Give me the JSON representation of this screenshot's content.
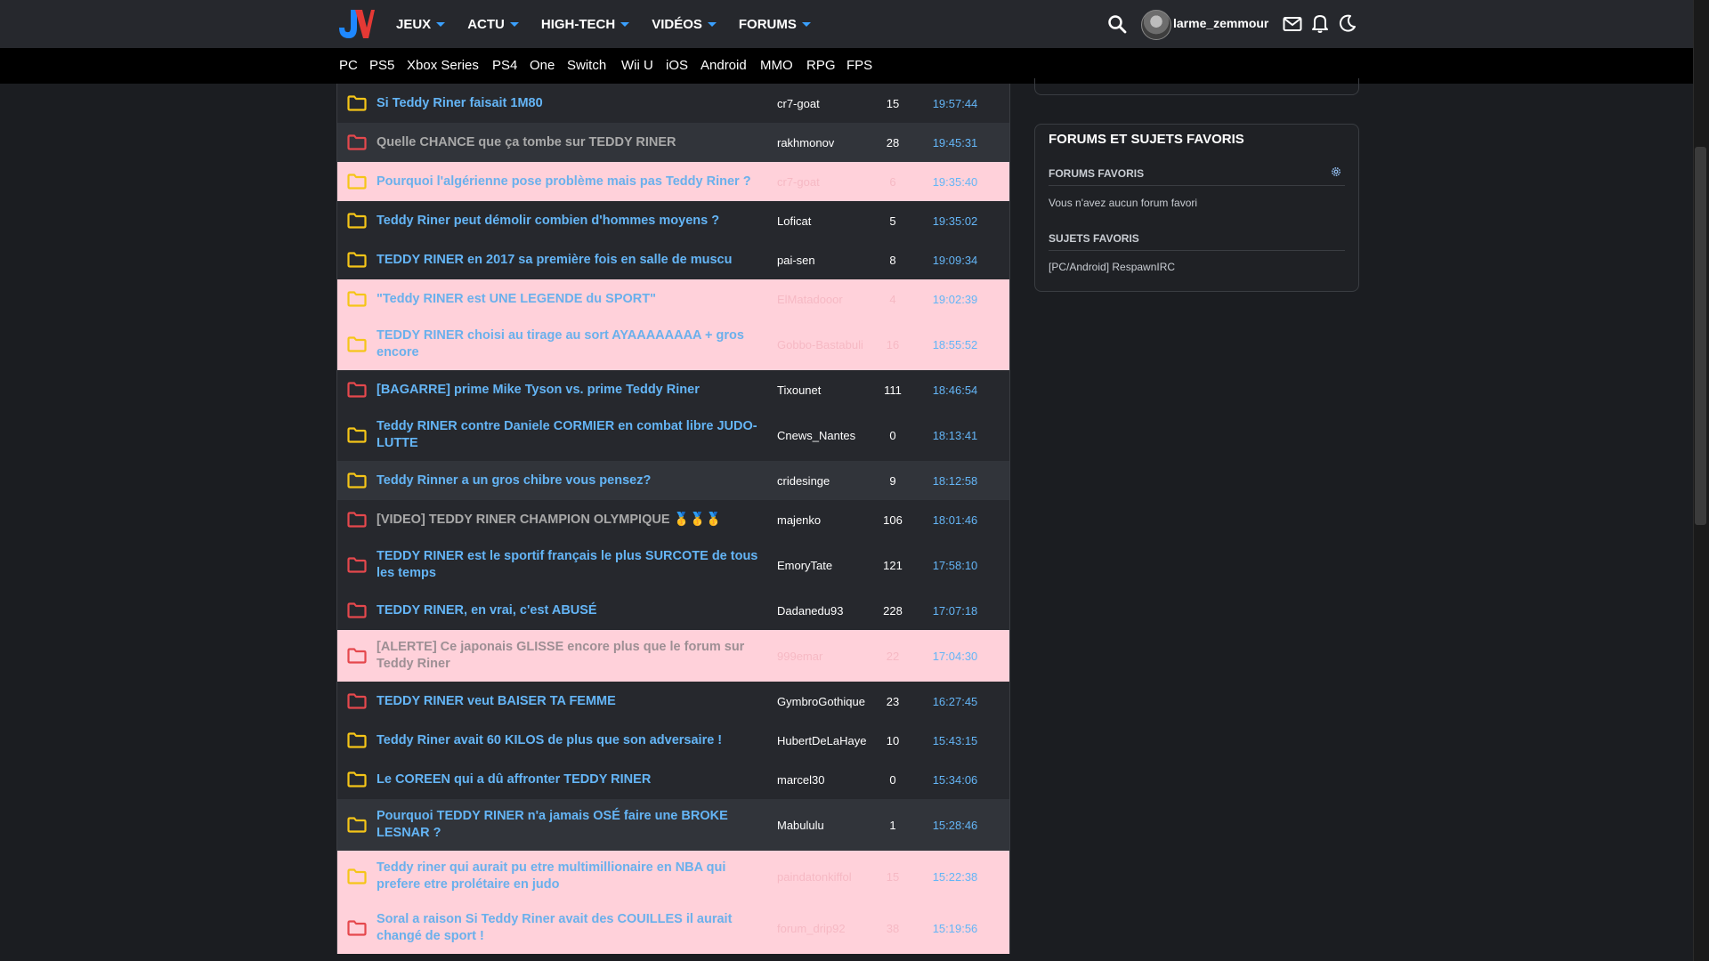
{
  "header": {
    "logo_text": "JV",
    "nav": [
      {
        "label": "JEUX"
      },
      {
        "label": "ACTU"
      },
      {
        "label": "HIGH-TECH"
      },
      {
        "label": "VIDÉOS"
      },
      {
        "label": "FORUMS"
      }
    ],
    "username": "larme_zemmour",
    "icons": [
      "search-icon",
      "mail-icon",
      "bell-icon",
      "moon-icon"
    ]
  },
  "platforms": [
    "PC",
    "PS5",
    "Xbox Series",
    "PS4",
    "One",
    "Switch",
    "Wii U",
    "iOS",
    "Android",
    "MMO",
    "RPG",
    "FPS"
  ],
  "topics": [
    {
      "title": "Si Teddy Riner faisait 1M80",
      "author": "cr7-goat",
      "count": "15",
      "time": "19:57:44",
      "folder": "yellow",
      "bg": "dark",
      "visited": false
    },
    {
      "title": "Quelle CHANCE que ça tombe sur TEDDY RINER",
      "author": "rakhmonov",
      "count": "28",
      "time": "19:45:31",
      "folder": "red",
      "bg": "med",
      "visited": true
    },
    {
      "title": "Pourquoi l'algérienne pose problème mais pas Teddy Riner ?",
      "author": "cr7-goat",
      "count": "6",
      "time": "19:35:40",
      "folder": "yellow",
      "bg": "pink",
      "visited": false
    },
    {
      "title": "Teddy Riner peut démolir combien d'hommes moyens ?",
      "author": "Loficat",
      "count": "5",
      "time": "19:35:02",
      "folder": "yellow",
      "bg": "dark",
      "visited": false
    },
    {
      "title": "TEDDY RINER en 2017 sa première fois en salle de muscu",
      "author": "pai-sen",
      "count": "8",
      "time": "19:09:34",
      "folder": "yellow",
      "bg": "dark",
      "visited": false
    },
    {
      "title": "\"Teddy RINER est UNE LEGENDE du SPORT\"",
      "author": "ElMatadooor",
      "count": "4",
      "time": "19:02:39",
      "folder": "yellow",
      "bg": "pink",
      "visited": false
    },
    {
      "title": "TEDDY RINER choisi au tirage au sort AYAAAAAAAA + gros encore",
      "author": "Gobbo-Bastabuli",
      "count": "16",
      "time": "18:55:52",
      "folder": "yellow",
      "bg": "pink",
      "visited": false
    },
    {
      "title": "[BAGARRE] prime Mike Tyson vs. prime Teddy Riner",
      "author": "Tixounet",
      "count": "111",
      "time": "18:46:54",
      "folder": "red",
      "bg": "dark",
      "visited": false
    },
    {
      "title": "Teddy RINER contre Daniele CORMIER en combat libre JUDO-LUTTE",
      "author": "Cnews_Nantes",
      "count": "0",
      "time": "18:13:41",
      "folder": "yellow",
      "bg": "dark",
      "visited": false
    },
    {
      "title": "Teddy Rinner a un gros chibre vous pensez?",
      "author": "cridesinge",
      "count": "9",
      "time": "18:12:58",
      "folder": "yellow",
      "bg": "med",
      "visited": false
    },
    {
      "title": "[VIDEO] TEDDY RINER CHAMPION OLYMPIQUE 🥇🥇🥇",
      "author": "majenko",
      "count": "106",
      "time": "18:01:46",
      "folder": "red",
      "bg": "dark",
      "visited": true
    },
    {
      "title": "TEDDY RINER est le sportif français le plus SURCOTE de tous les temps",
      "author": "EmoryTate",
      "count": "121",
      "time": "17:58:10",
      "folder": "red",
      "bg": "dark",
      "visited": false
    },
    {
      "title": "TEDDY RINER, en vrai, c'est ABUSÉ",
      "author": "Dadanedu93",
      "count": "228",
      "time": "17:07:18",
      "folder": "red",
      "bg": "dark",
      "visited": false
    },
    {
      "title": "[ALERTE] Ce japonais GLISSE encore plus que le forum sur Teddy Riner",
      "author": "999emar",
      "count": "22",
      "time": "17:04:30",
      "folder": "red",
      "bg": "pink",
      "visited": true
    },
    {
      "title": "TEDDY RINER veut BAISER TA FEMME",
      "author": "GymbroGothique",
      "count": "23",
      "time": "16:27:45",
      "folder": "red",
      "bg": "dark",
      "visited": false
    },
    {
      "title": "Teddy Riner avait 60 KILOS de plus que son adversaire !",
      "author": "HubertDeLaHaye",
      "count": "10",
      "time": "15:43:15",
      "folder": "yellow",
      "bg": "dark",
      "visited": false
    },
    {
      "title": "Le COREEN qui a dû affronter TEDDY RINER",
      "author": "marcel30",
      "count": "0",
      "time": "15:34:06",
      "folder": "yellow",
      "bg": "dark",
      "visited": false
    },
    {
      "title": "Pourquoi TEDDY RINER n'a jamais OSÉ faire une BROKE LESNAR ?",
      "author": "Mabululu",
      "count": "1",
      "time": "15:28:46",
      "folder": "yellow",
      "bg": "med",
      "visited": false
    },
    {
      "title": "Teddy riner qui aurait pu etre multimillionaire en NBA qui prefere etre prolétaire en judo",
      "author": "paindatonkiffol",
      "count": "15",
      "time": "15:22:38",
      "folder": "yellow",
      "bg": "pink",
      "visited": false
    },
    {
      "title": "Soral a raison Si Teddy Riner avait des COUILLES il aurait changé de sport !",
      "author": "forum_drip92",
      "count": "38",
      "time": "15:19:56",
      "folder": "red",
      "bg": "pink",
      "visited": false
    }
  ],
  "sidebar": {
    "title": "FORUMS ET SUJETS FAVORIS",
    "forums_label": "FORUMS FAVORIS",
    "forums_empty": "Vous n'avez aucun forum favori",
    "topics_label": "SUJETS FAVORIS",
    "topic_item": "[PC/Android] RespawnIRC"
  },
  "colors": {
    "accent": "#3aa0ff",
    "link": "#64b5f6",
    "folder_yellow": "#f5c518",
    "folder_red": "#e5484d",
    "highlight_row": "#ffd1da"
  }
}
